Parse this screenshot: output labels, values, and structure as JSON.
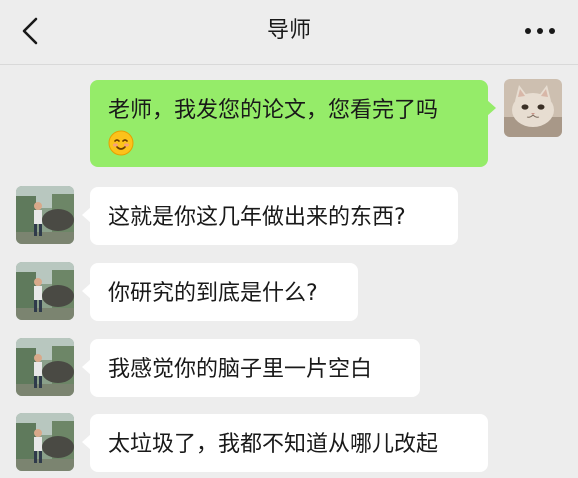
{
  "header": {
    "title": "导师",
    "back_icon": "chevron-left-icon",
    "more_icon": "more-dots-icon"
  },
  "messages": [
    {
      "sender": "me",
      "text": "老师，我发您的论文，您看完了吗",
      "emoji": "smiling-face-icon"
    },
    {
      "sender": "mentor",
      "text": "这就是你这几年做出来的东西?"
    },
    {
      "sender": "mentor",
      "text": "你研究的到底是什么?"
    },
    {
      "sender": "mentor",
      "text": "我感觉你的脑子里一片空白"
    },
    {
      "sender": "mentor",
      "text": "太垃圾了，我都不知道从哪儿改起"
    }
  ],
  "colors": {
    "background": "#ededed",
    "my_bubble": "#95ec69",
    "their_bubble": "#ffffff",
    "text": "#191919"
  }
}
